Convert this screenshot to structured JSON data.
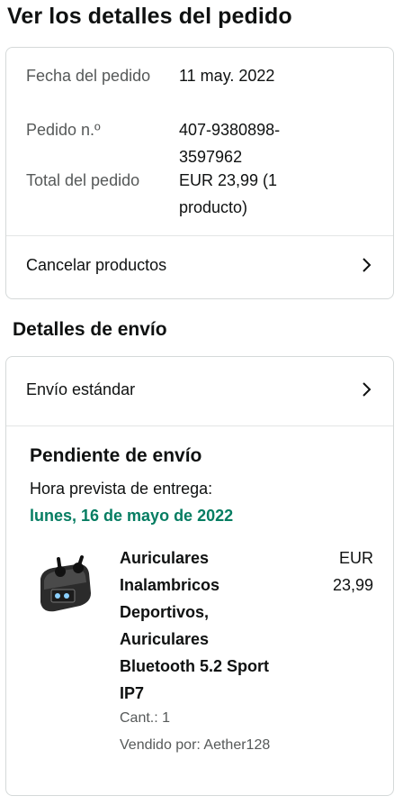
{
  "page": {
    "title": "Ver los detalles del pedido"
  },
  "order": {
    "date_label": "Fecha del pedido",
    "date_value": "11 may. 2022",
    "number_label": "Pedido n.º",
    "number_value": "407-9380898-3597962",
    "total_label": "Total del pedido",
    "total_value": "EUR 23,99 (1 producto)",
    "cancel_label": "Cancelar productos"
  },
  "shipping": {
    "section_title": "Detalles de envío",
    "method_label": "Envío estándar",
    "status": "Pendiente de envío",
    "eta_label": "Hora prevista de entrega:",
    "eta_date": "lunes, 16 de mayo de 2022"
  },
  "product": {
    "title": "Auriculares Inalambricos Deportivos, Auriculares Bluetooth 5.2 Sport IP7",
    "price": "EUR 23,99",
    "quantity": "Cant.: 1",
    "seller": "Vendido por: Aether128"
  },
  "colors": {
    "eta_green": "#067d62",
    "border": "#d5d9d9",
    "secondary_text": "#565959"
  },
  "icons": {
    "chevron": "chevron-right-icon",
    "product_image": "earbuds-case-image"
  }
}
